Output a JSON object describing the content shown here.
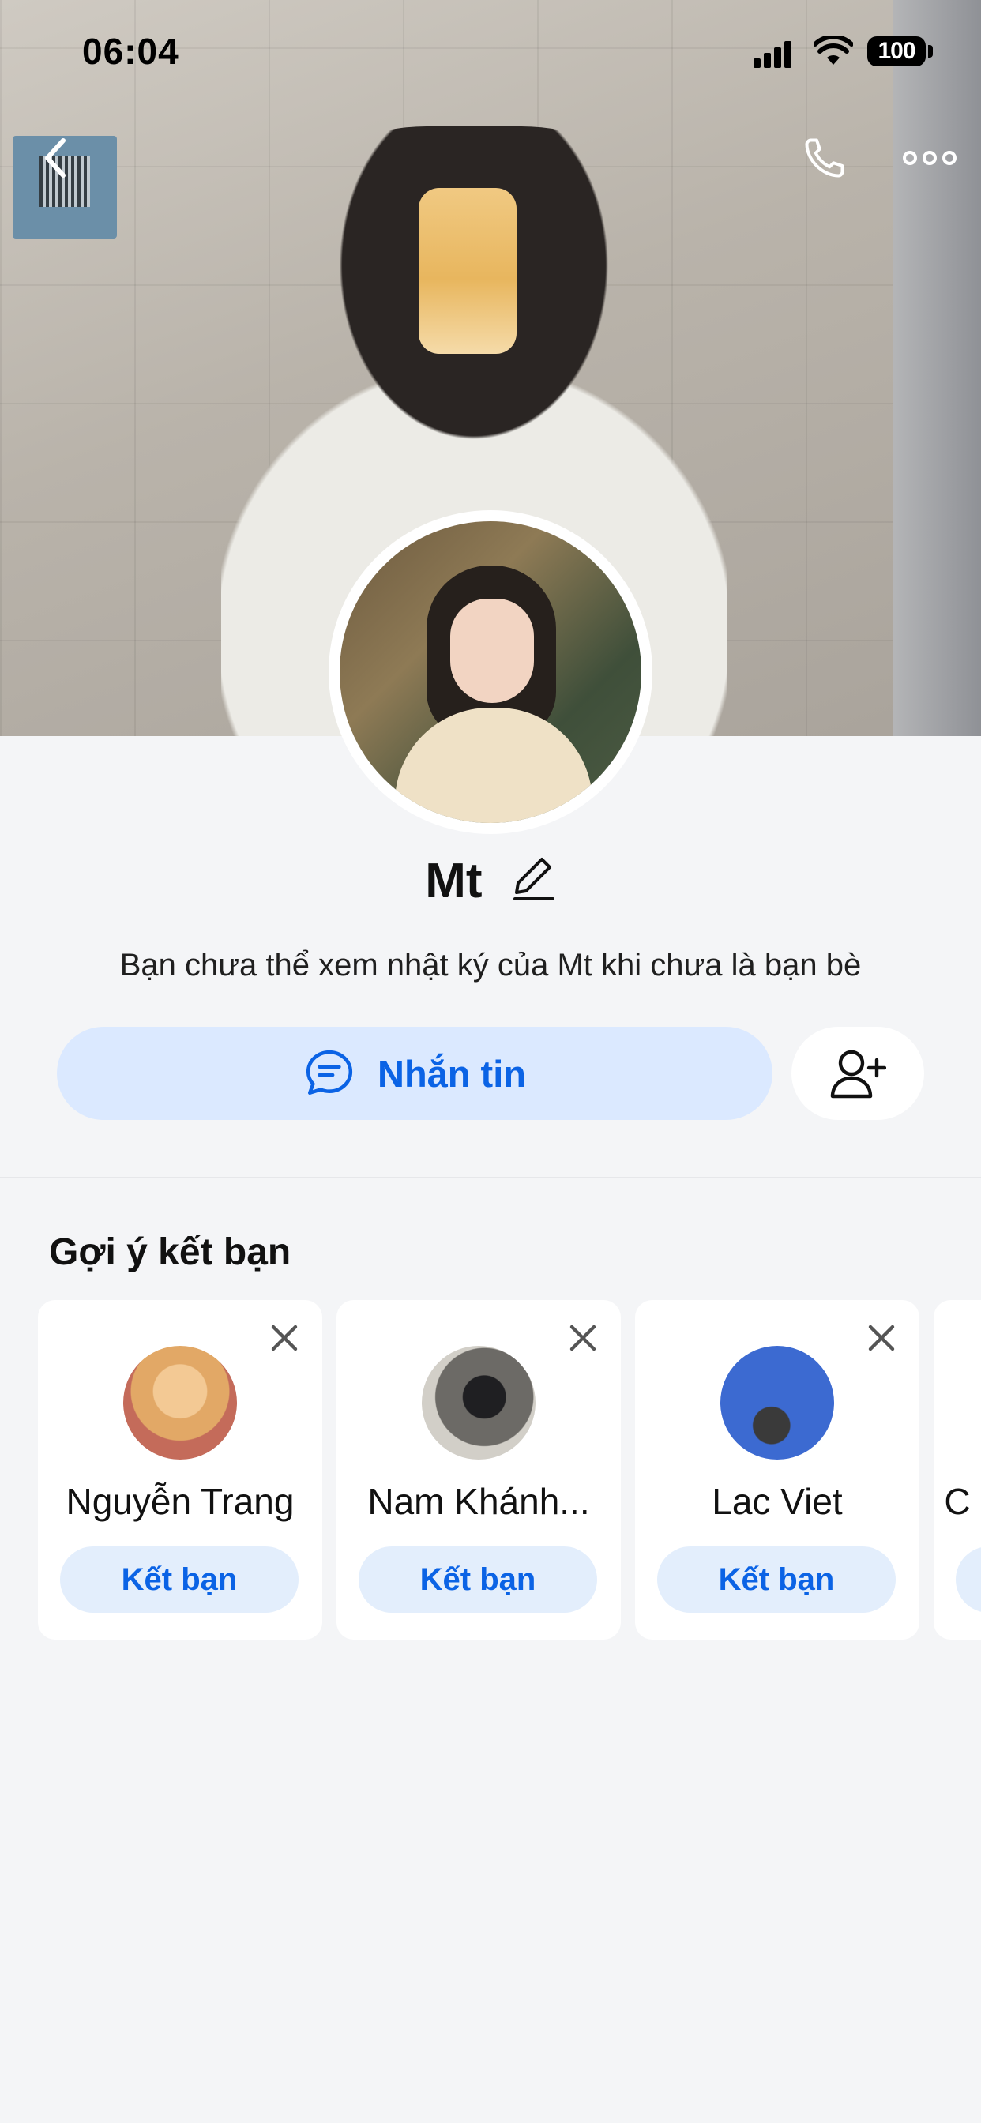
{
  "status_bar": {
    "time": "06:04",
    "battery": "100"
  },
  "profile": {
    "name": "Mt",
    "notice": "Bạn chưa thể xem nhật ký của Mt khi chưa là bạn bè",
    "message_button_label": "Nhắn tin"
  },
  "suggestions": {
    "title": "Gợi ý kết bạn",
    "add_label": "Kết bạn",
    "items": [
      {
        "name": "Nguyễn Trang"
      },
      {
        "name": "Nam Khánh..."
      },
      {
        "name": "Lac Viet"
      },
      {
        "name": "C"
      }
    ]
  },
  "icons": {
    "back": "chevron-left-icon",
    "call": "phone-icon",
    "more": "more-dots-icon",
    "edit": "pencil-icon",
    "message": "chat-bubble-icon",
    "add_friend": "add-user-icon",
    "dismiss": "close-icon"
  },
  "colors": {
    "accent": "#0b63e5",
    "accent_light": "#dbe9ff",
    "background": "#f4f5f7"
  }
}
